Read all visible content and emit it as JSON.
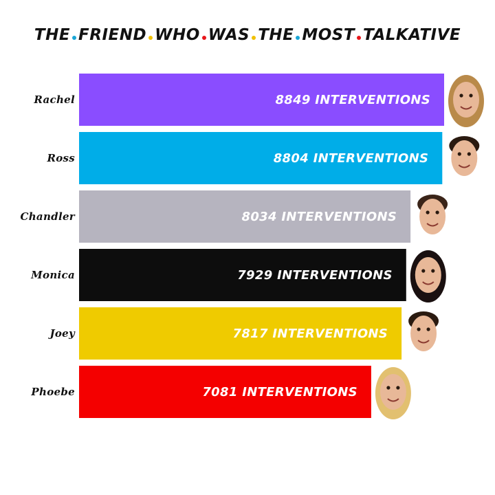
{
  "chart_data": {
    "type": "bar",
    "orientation": "horizontal",
    "title": "The friend who was the most talkative",
    "title_words": [
      "The",
      "friend",
      "who",
      "was",
      "the",
      "most",
      "talkative"
    ],
    "title_dot_colors": [
      "#1aa6d6",
      "#f0c000",
      "#e8161a",
      "#f0c000",
      "#1aa6d6",
      "#e8161a"
    ],
    "categories": [
      "Rachel",
      "Ross",
      "Chandler",
      "Monica",
      "Joey",
      "Phoebe"
    ],
    "values": [
      8849,
      8804,
      8034,
      7929,
      7817,
      7081
    ],
    "value_labels": [
      "8849 interventions",
      "8804 interventions",
      "8034 interventions",
      "7929 interventions",
      "7817 interventions",
      "7081 interventions"
    ],
    "colors": [
      "#8a4dff",
      "#00ade8",
      "#b6b4bf",
      "#0d0d0d",
      "#efcb00",
      "#f40000"
    ],
    "grid": false,
    "legend": "none"
  },
  "portraits": [
    "face-rachel-icon",
    "face-ross-icon",
    "face-chandler-icon",
    "face-monica-icon",
    "face-joey-icon",
    "face-phoebe-icon"
  ]
}
